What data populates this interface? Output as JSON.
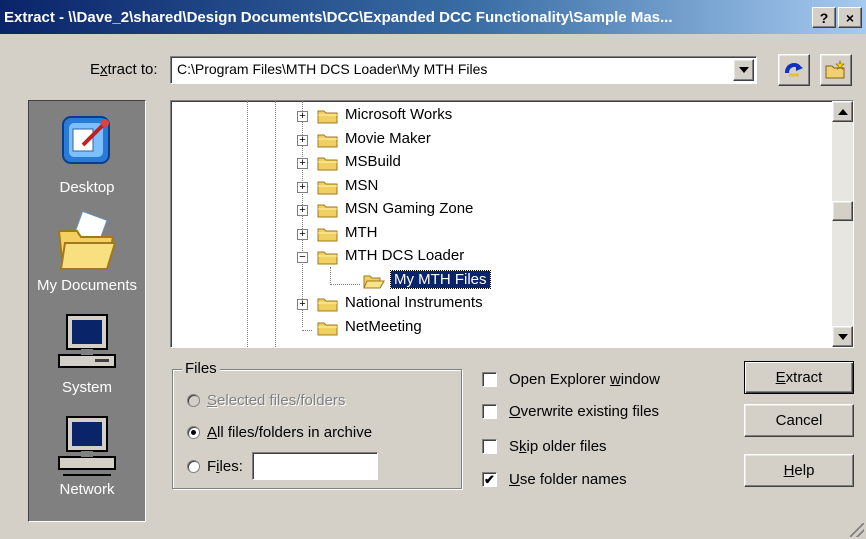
{
  "window": {
    "title": "Extract - \\\\Dave_2\\shared\\Design Documents\\DCC\\Expanded DCC Functionality\\Sample Mas...",
    "help_btn": "?",
    "close_btn": "×"
  },
  "extract_to": {
    "label_prefix": "E",
    "label_accel": "x",
    "label_suffix": "tract to:",
    "value": "C:\\Program Files\\MTH DCS Loader\\My MTH Files"
  },
  "toolbar": {
    "up_icon": "up-folder-icon",
    "new_folder_icon": "new-folder-icon"
  },
  "places": [
    {
      "label": "Desktop",
      "icon": "desktop-icon"
    },
    {
      "label": "My Documents",
      "icon": "my-documents-icon"
    },
    {
      "label": "System",
      "icon": "computer-icon"
    },
    {
      "label": "Network",
      "icon": "network-icon"
    }
  ],
  "tree": {
    "items": [
      {
        "label": "Microsoft Works",
        "expander": "+"
      },
      {
        "label": "Movie Maker",
        "expander": "+"
      },
      {
        "label": "MSBuild",
        "expander": "+"
      },
      {
        "label": "MSN",
        "expander": "+"
      },
      {
        "label": "MSN Gaming Zone",
        "expander": "+"
      },
      {
        "label": "MTH",
        "expander": "+"
      },
      {
        "label": "MTH DCS Loader",
        "expander": "−"
      },
      {
        "label": "My MTH Files",
        "expander": ""
      },
      {
        "label": "National Instruments",
        "expander": "+"
      },
      {
        "label": "NetMeeting",
        "expander": ""
      }
    ]
  },
  "files_group": {
    "legend": "Files",
    "opt_selected": {
      "accel": "S",
      "rest": "elected files/folders"
    },
    "opt_all": {
      "accel": "A",
      "rest": "ll files/folders in archive"
    },
    "opt_files": {
      "accel": "i",
      "pre": "F",
      "rest": "les:"
    },
    "files_value": ""
  },
  "options": {
    "open_explorer": {
      "pre": "Open Explorer ",
      "accel": "w",
      "rest": "indow",
      "checked": false
    },
    "overwrite": {
      "pre": "",
      "accel": "O",
      "rest": "verwrite existing files",
      "checked": false
    },
    "skip_older": {
      "pre": "S",
      "accel": "k",
      "rest": "ip older files",
      "checked": false
    },
    "use_folder_names": {
      "pre": "",
      "accel": "U",
      "rest": "se folder names",
      "checked": true
    }
  },
  "buttons": {
    "extract": {
      "accel": "E",
      "rest": "xtract"
    },
    "cancel": "Cancel",
    "help": {
      "accel": "H",
      "rest": "elp"
    }
  },
  "check_mark": "✔"
}
